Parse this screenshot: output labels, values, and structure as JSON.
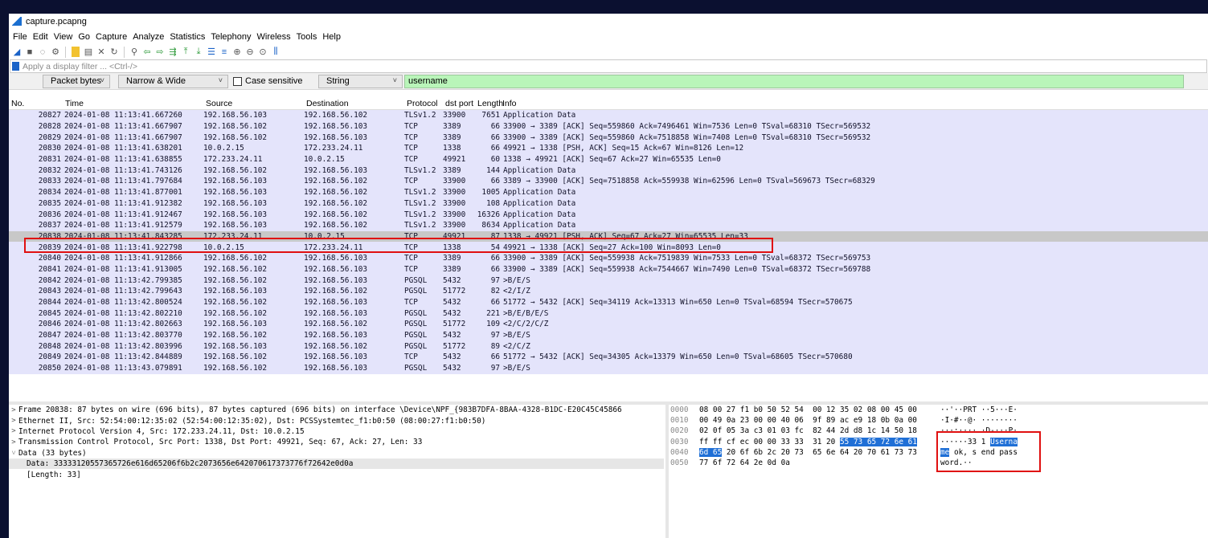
{
  "window": {
    "title": "capture.pcapng"
  },
  "menu": [
    "File",
    "Edit",
    "View",
    "Go",
    "Capture",
    "Analyze",
    "Statistics",
    "Telephony",
    "Wireless",
    "Tools",
    "Help"
  ],
  "filter": {
    "placeholder": "Apply a display filter ... <Ctrl-/>"
  },
  "find": {
    "search_in": "Packet bytes",
    "char_width": "Narrow & Wide",
    "case_sensitive_label": "Case sensitive",
    "type": "String",
    "value": "username"
  },
  "columns": [
    "No.",
    "Time",
    "Source",
    "Destination",
    "Protocol",
    "dst port",
    "Length",
    "Info"
  ],
  "packets": [
    [
      "20827",
      "2024-01-08 11:13:41.667260",
      "192.168.56.103",
      "192.168.56.102",
      "TLSv1.2",
      "33900",
      "7651",
      "Application Data"
    ],
    [
      "20828",
      "2024-01-08 11:13:41.667907",
      "192.168.56.102",
      "192.168.56.103",
      "TCP",
      "3389",
      "66",
      "33900 → 3389 [ACK] Seq=559860 Ack=7496461 Win=7536 Len=0 TSval=68310 TSecr=569532"
    ],
    [
      "20829",
      "2024-01-08 11:13:41.667907",
      "192.168.56.102",
      "192.168.56.103",
      "TCP",
      "3389",
      "66",
      "33900 → 3389 [ACK] Seq=559860 Ack=7518858 Win=7408 Len=0 TSval=68310 TSecr=569532"
    ],
    [
      "20830",
      "2024-01-08 11:13:41.638201",
      "10.0.2.15",
      "172.233.24.11",
      "TCP",
      "1338",
      "66",
      "49921 → 1338 [PSH, ACK] Seq=15 Ack=67 Win=8126 Len=12"
    ],
    [
      "20831",
      "2024-01-08 11:13:41.638855",
      "172.233.24.11",
      "10.0.2.15",
      "TCP",
      "49921",
      "60",
      "1338 → 49921 [ACK] Seq=67 Ack=27 Win=65535 Len=0"
    ],
    [
      "20832",
      "2024-01-08 11:13:41.743126",
      "192.168.56.102",
      "192.168.56.103",
      "TLSv1.2",
      "3389",
      "144",
      "Application Data"
    ],
    [
      "20833",
      "2024-01-08 11:13:41.797684",
      "192.168.56.103",
      "192.168.56.102",
      "TCP",
      "33900",
      "66",
      "3389 → 33900 [ACK] Seq=7518858 Ack=559938 Win=62596 Len=0 TSval=569673 TSecr=68329"
    ],
    [
      "20834",
      "2024-01-08 11:13:41.877001",
      "192.168.56.103",
      "192.168.56.102",
      "TLSv1.2",
      "33900",
      "1005",
      "Application Data"
    ],
    [
      "20835",
      "2024-01-08 11:13:41.912382",
      "192.168.56.103",
      "192.168.56.102",
      "TLSv1.2",
      "33900",
      "108",
      "Application Data"
    ],
    [
      "20836",
      "2024-01-08 11:13:41.912467",
      "192.168.56.103",
      "192.168.56.102",
      "TLSv1.2",
      "33900",
      "16326",
      "Application Data"
    ],
    [
      "20837",
      "2024-01-08 11:13:41.912579",
      "192.168.56.103",
      "192.168.56.102",
      "TLSv1.2",
      "33900",
      "8634",
      "Application Data"
    ],
    [
      "20838",
      "2024-01-08 11:13:41.843285",
      "172.233.24.11",
      "10.0.2.15",
      "TCP",
      "49921",
      "87",
      "1338 → 49921 [PSH, ACK] Seq=67 Ack=27 Win=65535 Len=33"
    ],
    [
      "20839",
      "2024-01-08 11:13:41.922798",
      "10.0.2.15",
      "172.233.24.11",
      "TCP",
      "1338",
      "54",
      "49921 → 1338 [ACK] Seq=27 Ack=100 Win=8093 Len=0"
    ],
    [
      "20840",
      "2024-01-08 11:13:41.912866",
      "192.168.56.102",
      "192.168.56.103",
      "TCP",
      "3389",
      "66",
      "33900 → 3389 [ACK] Seq=559938 Ack=7519839 Win=7533 Len=0 TSval=68372 TSecr=569753"
    ],
    [
      "20841",
      "2024-01-08 11:13:41.913005",
      "192.168.56.102",
      "192.168.56.103",
      "TCP",
      "3389",
      "66",
      "33900 → 3389 [ACK] Seq=559938 Ack=7544667 Win=7490 Len=0 TSval=68372 TSecr=569788"
    ],
    [
      "20842",
      "2024-01-08 11:13:42.799385",
      "192.168.56.102",
      "192.168.56.103",
      "PGSQL",
      "5432",
      "97",
      ">B/E/S"
    ],
    [
      "20843",
      "2024-01-08 11:13:42.799643",
      "192.168.56.103",
      "192.168.56.102",
      "PGSQL",
      "51772",
      "82",
      "<2/I/Z"
    ],
    [
      "20844",
      "2024-01-08 11:13:42.800524",
      "192.168.56.102",
      "192.168.56.103",
      "TCP",
      "5432",
      "66",
      "51772 → 5432 [ACK] Seq=34119 Ack=13313 Win=650 Len=0 TSval=68594 TSecr=570675"
    ],
    [
      "20845",
      "2024-01-08 11:13:42.802210",
      "192.168.56.102",
      "192.168.56.103",
      "PGSQL",
      "5432",
      "221",
      ">B/E/B/E/S"
    ],
    [
      "20846",
      "2024-01-08 11:13:42.802663",
      "192.168.56.103",
      "192.168.56.102",
      "PGSQL",
      "51772",
      "109",
      "<2/C/2/C/Z"
    ],
    [
      "20847",
      "2024-01-08 11:13:42.803770",
      "192.168.56.102",
      "192.168.56.103",
      "PGSQL",
      "5432",
      "97",
      ">B/E/S"
    ],
    [
      "20848",
      "2024-01-08 11:13:42.803996",
      "192.168.56.103",
      "192.168.56.102",
      "PGSQL",
      "51772",
      "89",
      "<2/C/Z"
    ],
    [
      "20849",
      "2024-01-08 11:13:42.844889",
      "192.168.56.102",
      "192.168.56.103",
      "TCP",
      "5432",
      "66",
      "51772 → 5432 [ACK] Seq=34305 Ack=13379 Win=650 Len=0 TSval=68605 TSecr=570680"
    ],
    [
      "20850",
      "2024-01-08 11:13:43.079891",
      "192.168.56.102",
      "192.168.56.103",
      "PGSQL",
      "5432",
      "97",
      ">B/E/S"
    ]
  ],
  "selected_packet": "20838",
  "details": [
    {
      "tw": ">",
      "text": "Frame 20838: 87 bytes on wire (696 bits), 87 bytes captured (696 bits) on interface \\Device\\NPF_{983B7DFA-8BAA-4328-B1DC-E20C45C45866"
    },
    {
      "tw": ">",
      "text": "Ethernet II, Src: 52:54:00:12:35:02 (52:54:00:12:35:02), Dst: PCSSystemtec_f1:b0:50 (08:00:27:f1:b0:50)"
    },
    {
      "tw": ">",
      "text": "Internet Protocol Version 4, Src: 172.233.24.11, Dst: 10.0.2.15"
    },
    {
      "tw": ">",
      "text": "Transmission Control Protocol, Src Port: 1338, Dst Port: 49921, Seq: 67, Ack: 27, Len: 33"
    },
    {
      "tw": "˅",
      "text": "Data (33 bytes)"
    }
  ],
  "details_children": [
    "Data: 33333120557365726e616d65206f6b2c2073656e642070617373776f72642e0d0a",
    "[Length: 33]"
  ],
  "bytes": [
    {
      "off": "0000",
      "hex": "08 00 27 f1 b0 50 52 54  00 12 35 02 08 00 45 00",
      "ascii": "··'··PRT ··5···E·"
    },
    {
      "off": "0010",
      "hex": "00 49 0a 23 00 00 40 06  9f 89 ac e9 18 0b 0a 00",
      "ascii": "·I·#··@· ········"
    },
    {
      "off": "0020",
      "hex": "02 0f 05 3a c3 01 03 fc  82 44 2d d8 1c 14 50 18",
      "ascii": "···:···· ·D-···P·"
    },
    {
      "off": "0030",
      "hex_pre": "ff ff cf ec 00 00 33 33  31 20 ",
      "hex_sel": "55 73 65 72 6e 61",
      "ascii_pre": "······33 1 ",
      "ascii_sel": "Userna"
    },
    {
      "off": "0040",
      "hex_sel": "6d 65",
      "hex_post": " 20 6f 6b 2c 20 73  65 6e 64 20 70 61 73 73",
      "ascii_sel": "me",
      "ascii_post": " ok, s end pass"
    },
    {
      "off": "0050",
      "hex": "77 6f 72 64 2e 0d 0a",
      "ascii": "word.··"
    }
  ]
}
